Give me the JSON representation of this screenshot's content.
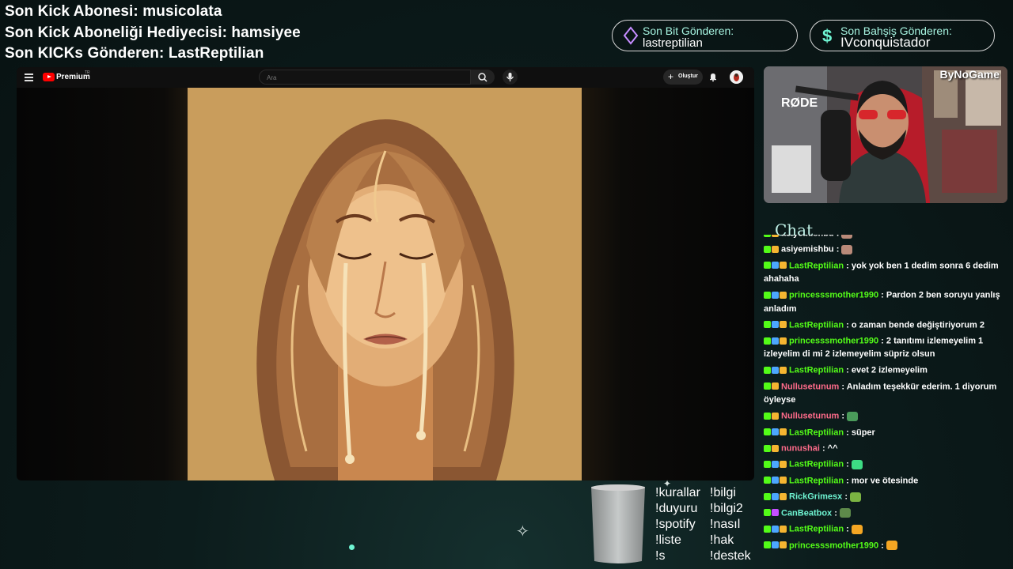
{
  "ticker": [
    {
      "label": "Son Kick Abonesi:",
      "value": "musicolata"
    },
    {
      "label": "Son Kick Aboneliği Hediyecisi:",
      "value": "hamsiyee"
    },
    {
      "label": "Son KICKs Gönderen:",
      "value": "LastReptilian"
    }
  ],
  "pills": [
    {
      "title": "Son Bit Gönderen:",
      "value": "lastreptilian",
      "icon": "diamond-icon",
      "color": "#c58cff"
    },
    {
      "title": "Son Bahşiş Gönderen:",
      "value": "IVconquistador",
      "icon": "dollar-icon",
      "color": "#6ff5d3"
    }
  ],
  "youtube": {
    "brand": "Premium",
    "brand_sup": "TR",
    "search_placeholder": "Ara",
    "create_label": "Oluştur"
  },
  "webcam": {
    "logo": "ByNoGame",
    "mic_brand": "RØDE"
  },
  "chat": {
    "title": "Chat",
    "messages": [
      {
        "user": "asiyemishbu",
        "color": "#ffffff",
        "text": "",
        "badges": [
          "k",
          "c"
        ],
        "emote": "#b98a79"
      },
      {
        "user": "asiyemishbu",
        "color": "#ffffff",
        "text": "",
        "badges": [
          "k",
          "c"
        ],
        "emote": "#b98a79"
      },
      {
        "user": "LastReptilian",
        "color": "#53fc18",
        "text": "yok yok ben 1 dedim sonra 6 dedim ahahaha",
        "badges": [
          "k",
          "s",
          "c"
        ]
      },
      {
        "user": "princesssmother1990",
        "color": "#53fc18",
        "text": "Pardon 2 ben soruyu yanlış anladım",
        "badges": [
          "k",
          "s",
          "c"
        ]
      },
      {
        "user": "LastReptilian",
        "color": "#53fc18",
        "text": "o zaman bende değiştiriyorum 2",
        "badges": [
          "k",
          "s",
          "c"
        ]
      },
      {
        "user": "princesssmother1990",
        "color": "#53fc18",
        "text": "2 tanıtımı izlemeyelim 1 izleyelim di mi 2 izlemeyelim süpriz olsun",
        "badges": [
          "k",
          "s",
          "c"
        ]
      },
      {
        "user": "LastReptilian",
        "color": "#53fc18",
        "text": "evet 2 izlemeyelim",
        "badges": [
          "k",
          "s",
          "c"
        ]
      },
      {
        "user": "Nullusetunum",
        "color": "#ff6b8a",
        "text": "Anladım teşekkür ederim. 1 diyorum öyleyse",
        "badges": [
          "k",
          "c"
        ]
      },
      {
        "user": "Nullusetunum",
        "color": "#ff6b8a",
        "text": "",
        "badges": [
          "k",
          "c"
        ],
        "emote": "#4a9b5a"
      },
      {
        "user": "LastReptilian",
        "color": "#53fc18",
        "text": "süper",
        "badges": [
          "k",
          "s",
          "c"
        ]
      },
      {
        "user": "nunushai",
        "color": "#ff6b8a",
        "text": "^^",
        "badges": [
          "k",
          "c"
        ]
      },
      {
        "user": "LastReptilian",
        "color": "#53fc18",
        "text": "",
        "badges": [
          "k",
          "s",
          "c"
        ],
        "emote": "#3ddc84"
      },
      {
        "user": "LastReptilian",
        "color": "#53fc18",
        "text": "mor ve ötesinde",
        "badges": [
          "k",
          "s",
          "c"
        ]
      },
      {
        "user": "RickGrimesx",
        "color": "#6ff5d3",
        "text": "",
        "badges": [
          "k",
          "s",
          "c"
        ],
        "emote": "#7bb342"
      },
      {
        "user": "CanBeatbox",
        "color": "#6ff5d3",
        "text": "",
        "badges": [
          "k",
          "m"
        ],
        "emote": "#5d8a4a"
      },
      {
        "user": "LastReptilian",
        "color": "#53fc18",
        "text": "",
        "badges": [
          "k",
          "s",
          "c"
        ],
        "emote": "#f5a623"
      },
      {
        "user": "princesssmother1990",
        "color": "#53fc18",
        "text": "",
        "badges": [
          "k",
          "s",
          "c"
        ],
        "emote": "#f5a623"
      }
    ]
  },
  "commands": {
    "col1": [
      "!kurallar",
      "!duyuru",
      "!spotify",
      "!liste",
      "!s"
    ],
    "col2": [
      "!bilgi",
      "!bilgi2",
      "!nasıl",
      "!hak",
      "!destek"
    ]
  }
}
